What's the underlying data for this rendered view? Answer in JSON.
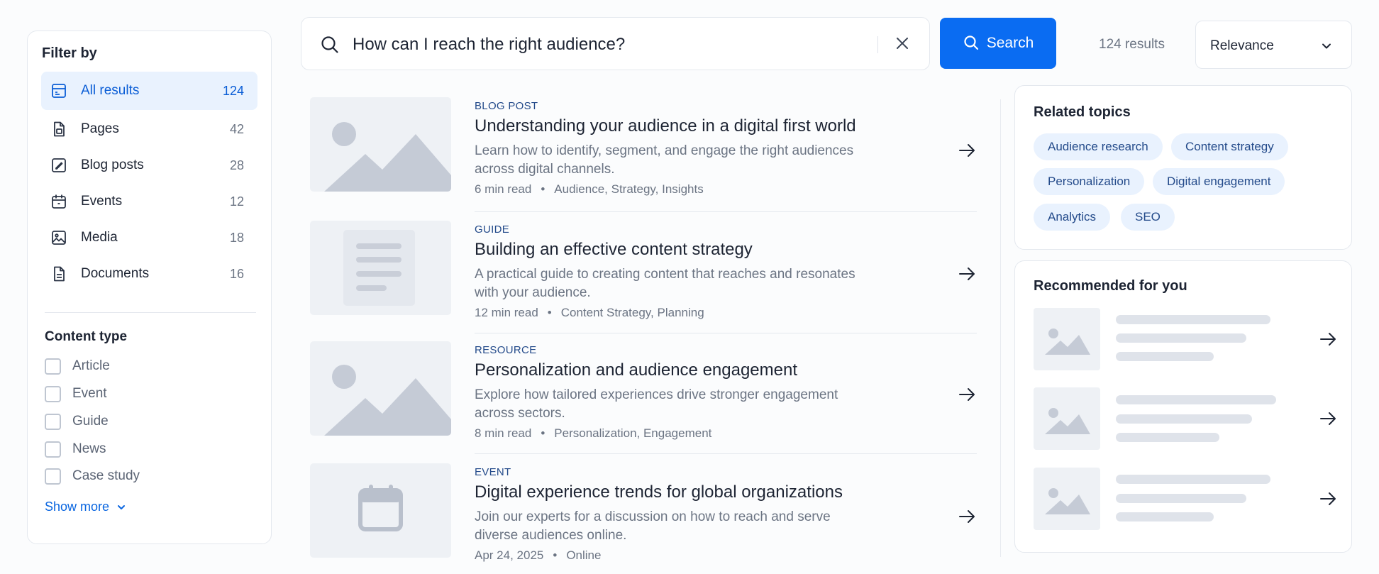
{
  "filter": {
    "heading": "Filter by",
    "nav": [
      {
        "label": "All results",
        "count": "124",
        "icon": "all-results-icon",
        "active": true
      },
      {
        "label": "Pages",
        "count": "42",
        "icon": "page-icon",
        "active": false
      },
      {
        "label": "Blog posts",
        "count": "28",
        "icon": "blog-post-icon",
        "active": false
      },
      {
        "label": "Events",
        "count": "12",
        "icon": "calendar-icon",
        "active": false
      },
      {
        "label": "Media",
        "count": "18",
        "icon": "image-icon",
        "active": false
      },
      {
        "label": "Documents",
        "count": "16",
        "icon": "document-icon",
        "active": false
      }
    ],
    "content_type": {
      "title": "Content type",
      "options": [
        {
          "label": "Article",
          "checked": false
        },
        {
          "label": "Event",
          "checked": false
        },
        {
          "label": "Guide",
          "checked": false
        },
        {
          "label": "News",
          "checked": false
        },
        {
          "label": "Case study",
          "checked": false
        }
      ]
    },
    "show_more": "Show more"
  },
  "search": {
    "query": "How can I reach the right audience?",
    "button_label": "Search",
    "result_count": "124 results",
    "sort": "Relevance"
  },
  "results": [
    {
      "kind": "BLOG POST",
      "title": "Understanding your audience in a digital first world",
      "description": "Learn how to identify, segment, and engage the right audiences across digital channels.",
      "meta_left": "6 min read",
      "meta_right": "Audience, Strategy, Insights",
      "thumb": "landscape-image-icon"
    },
    {
      "kind": "GUIDE",
      "title": "Building an effective content strategy",
      "description": "A practical guide to creating content that reaches and resonates with your audience.",
      "meta_left": "12 min read",
      "meta_right": "Content Strategy, Planning",
      "thumb": "document-lines-icon"
    },
    {
      "kind": "RESOURCE",
      "title": "Personalization and audience engagement",
      "description": "Explore how tailored experiences drive stronger engagement across sectors.",
      "meta_left": "8 min read",
      "meta_right": "Personalization, Engagement",
      "thumb": "landscape-image-icon"
    },
    {
      "kind": "EVENT",
      "title": "Digital experience trends for global organizations",
      "description": "Join our experts for a discussion on how to reach and serve diverse audiences online.",
      "meta_left": "Apr 24, 2025",
      "meta_right": "Online",
      "thumb": "calendar-icon"
    }
  ],
  "related": {
    "heading": "Related topics",
    "chips": [
      "Audience research",
      "Content strategy",
      "Personalization",
      "Digital engagement",
      "Analytics",
      "SEO"
    ]
  },
  "recommended": {
    "heading": "Recommended for you"
  },
  "colors": {
    "accent": "#0a6cf2",
    "active_bg": "#e9f2fe",
    "chip_text": "#234a8a",
    "placeholder": "#c5cbd6"
  }
}
